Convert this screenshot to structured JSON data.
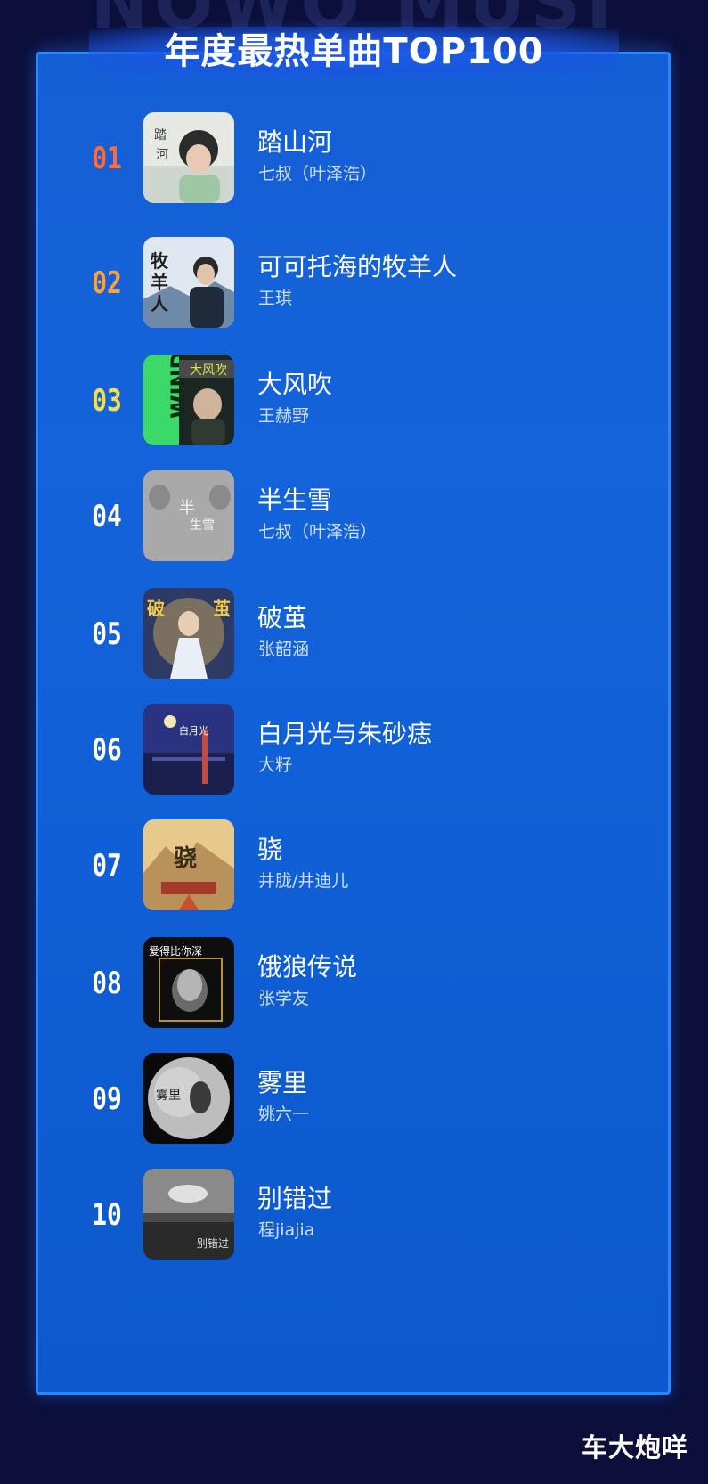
{
  "header": {
    "background_text": "NOWO MUSI",
    "title": "年度最热单曲TOP100"
  },
  "colors": {
    "rank_1": "#ff6a3d",
    "rank_2": "#ffa23a",
    "rank_3": "#f1e04a",
    "rank_default": "#ffffff",
    "panel": "#1463da",
    "panel_border": "#2a86ff",
    "page_bg": "#0b0f3a"
  },
  "songs": [
    {
      "rank": "01",
      "title": "踏山河",
      "artist": "七叔（叶泽浩）"
    },
    {
      "rank": "02",
      "title": "可可托海的牧羊人",
      "artist": "王琪"
    },
    {
      "rank": "03",
      "title": "大风吹",
      "artist": "王赫野"
    },
    {
      "rank": "04",
      "title": "半生雪",
      "artist": "七叔（叶泽浩）"
    },
    {
      "rank": "05",
      "title": "破茧",
      "artist": "张韶涵"
    },
    {
      "rank": "06",
      "title": "白月光与朱砂痣",
      "artist": "大籽"
    },
    {
      "rank": "07",
      "title": "骁",
      "artist": "井胧/井迪儿"
    },
    {
      "rank": "08",
      "title": "饿狼传说",
      "artist": "张学友"
    },
    {
      "rank": "09",
      "title": "雾里",
      "artist": "姚六一"
    },
    {
      "rank": "10",
      "title": "别错过",
      "artist": "程jiajia"
    }
  ],
  "watermark": {
    "author": "车大炮咩"
  }
}
